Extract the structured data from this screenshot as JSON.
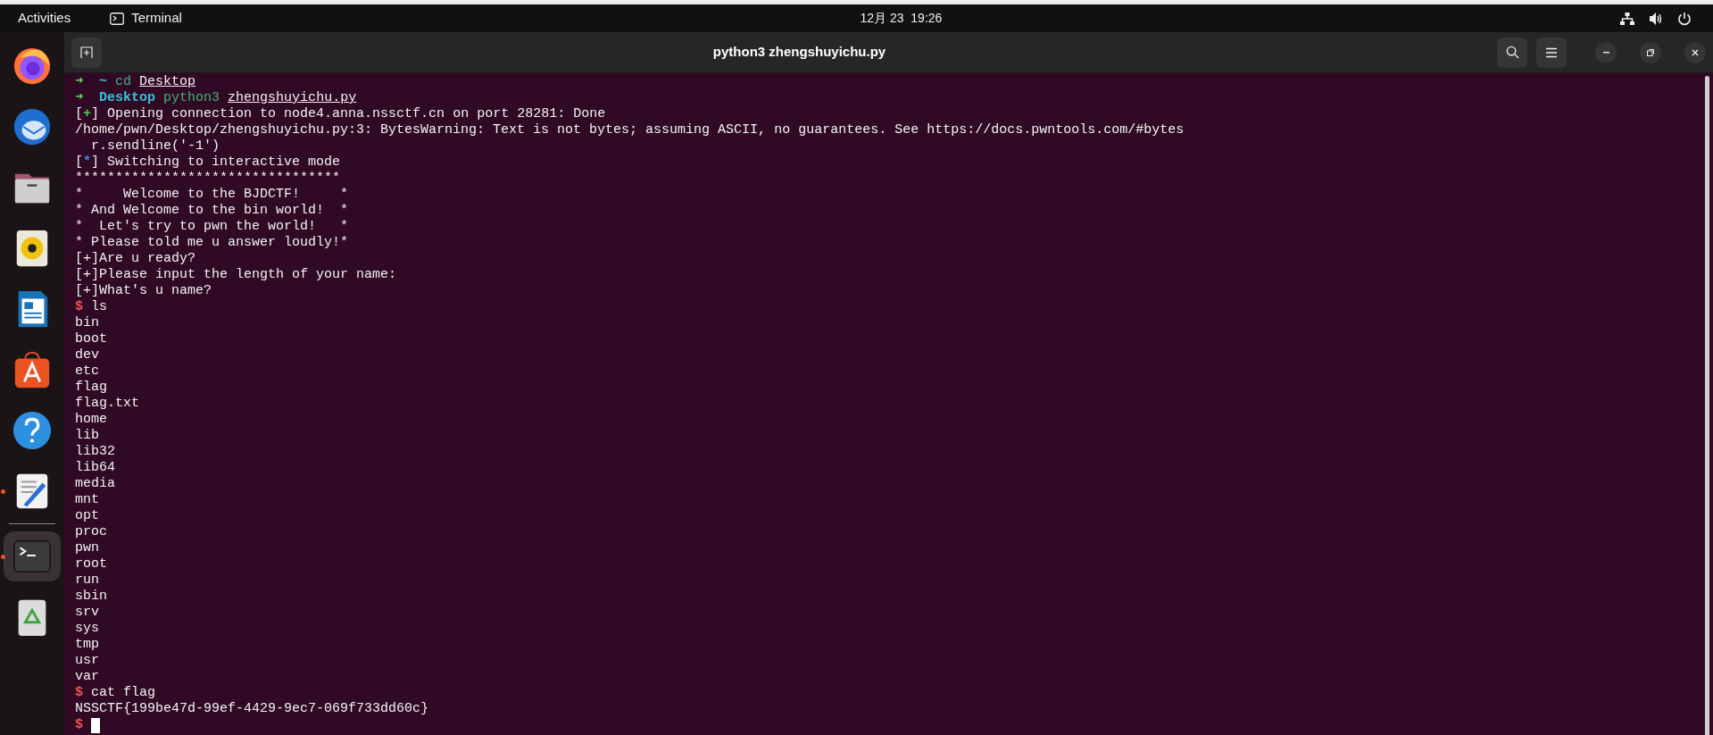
{
  "top_bar": {
    "activities": "Activities",
    "app_name": "Terminal",
    "clock": "12月 23  19:26"
  },
  "dock": [
    {
      "kind": "firefox",
      "running": false,
      "selected": false
    },
    {
      "kind": "mail",
      "running": false,
      "selected": false
    },
    {
      "kind": "files",
      "running": false,
      "selected": false
    },
    {
      "kind": "speaker",
      "running": false,
      "selected": false
    },
    {
      "kind": "writer",
      "running": false,
      "selected": false
    },
    {
      "kind": "store",
      "running": false,
      "selected": false
    },
    {
      "kind": "help",
      "running": false,
      "selected": false
    },
    {
      "kind": "editor",
      "running": true,
      "selected": false
    },
    {
      "kind": "terminal",
      "running": true,
      "selected": true
    },
    {
      "kind": "trash",
      "running": false,
      "selected": false
    }
  ],
  "window": {
    "title": "python3 zhengshuyichu.py"
  },
  "terminal_lines": [
    {
      "kind": "shell",
      "arrow": "➜",
      "dir": "~",
      "command": "cd",
      "arg": "Desktop"
    },
    {
      "kind": "shell",
      "arrow": "➜",
      "dir": "Desktop",
      "command": "python3",
      "arg": "zhengshuyichu.py"
    },
    {
      "kind": "status",
      "open": "[",
      "symbol": "+",
      "close": "]",
      "color": "#4cc94c",
      "text": "Opening connection to node4.anna.nssctf.cn on port 28281: Done"
    },
    {
      "kind": "output",
      "text": "/home/pwn/Desktop/zhengshuyichu.py:3: BytesWarning: Text is not bytes; assuming ASCII, no guarantees. See https://docs.pwntools.com/#bytes"
    },
    {
      "kind": "output",
      "text": "  r.sendline('-1')"
    },
    {
      "kind": "status",
      "open": "[",
      "symbol": "*",
      "close": "]",
      "color": "#3f8fe0",
      "text": "Switching to interactive mode"
    },
    {
      "kind": "output",
      "text": "*********************************"
    },
    {
      "kind": "output",
      "text": "*     Welcome to the BJDCTF!     *"
    },
    {
      "kind": "output",
      "text": "* And Welcome to the bin world!  *"
    },
    {
      "kind": "output",
      "text": "*  Let's try to pwn the world!   *"
    },
    {
      "kind": "output",
      "text": "* Please told me u answer loudly!*"
    },
    {
      "kind": "output",
      "text": "[+]Are u ready?"
    },
    {
      "kind": "output",
      "text": "[+]Please input the length of your name:"
    },
    {
      "kind": "output",
      "text": "[+]What's u name?"
    },
    {
      "kind": "input",
      "prompt": "$",
      "text": "ls",
      "cursor": false
    },
    {
      "kind": "output",
      "text": "bin"
    },
    {
      "kind": "output",
      "text": "boot"
    },
    {
      "kind": "output",
      "text": "dev"
    },
    {
      "kind": "output",
      "text": "etc"
    },
    {
      "kind": "output",
      "text": "flag"
    },
    {
      "kind": "output",
      "text": "flag.txt"
    },
    {
      "kind": "output",
      "text": "home"
    },
    {
      "kind": "output",
      "text": "lib"
    },
    {
      "kind": "output",
      "text": "lib32"
    },
    {
      "kind": "output",
      "text": "lib64"
    },
    {
      "kind": "output",
      "text": "media"
    },
    {
      "kind": "output",
      "text": "mnt"
    },
    {
      "kind": "output",
      "text": "opt"
    },
    {
      "kind": "output",
      "text": "proc"
    },
    {
      "kind": "output",
      "text": "pwn"
    },
    {
      "kind": "output",
      "text": "root"
    },
    {
      "kind": "output",
      "text": "run"
    },
    {
      "kind": "output",
      "text": "sbin"
    },
    {
      "kind": "output",
      "text": "srv"
    },
    {
      "kind": "output",
      "text": "sys"
    },
    {
      "kind": "output",
      "text": "tmp"
    },
    {
      "kind": "output",
      "text": "usr"
    },
    {
      "kind": "output",
      "text": "var"
    },
    {
      "kind": "input",
      "prompt": "$",
      "text": "cat flag",
      "cursor": false
    },
    {
      "kind": "output",
      "text": "NSSCTF{199be47d-99ef-4429-9ec7-069f733dd60c}"
    },
    {
      "kind": "input",
      "prompt": "$",
      "cursor": true
    }
  ]
}
